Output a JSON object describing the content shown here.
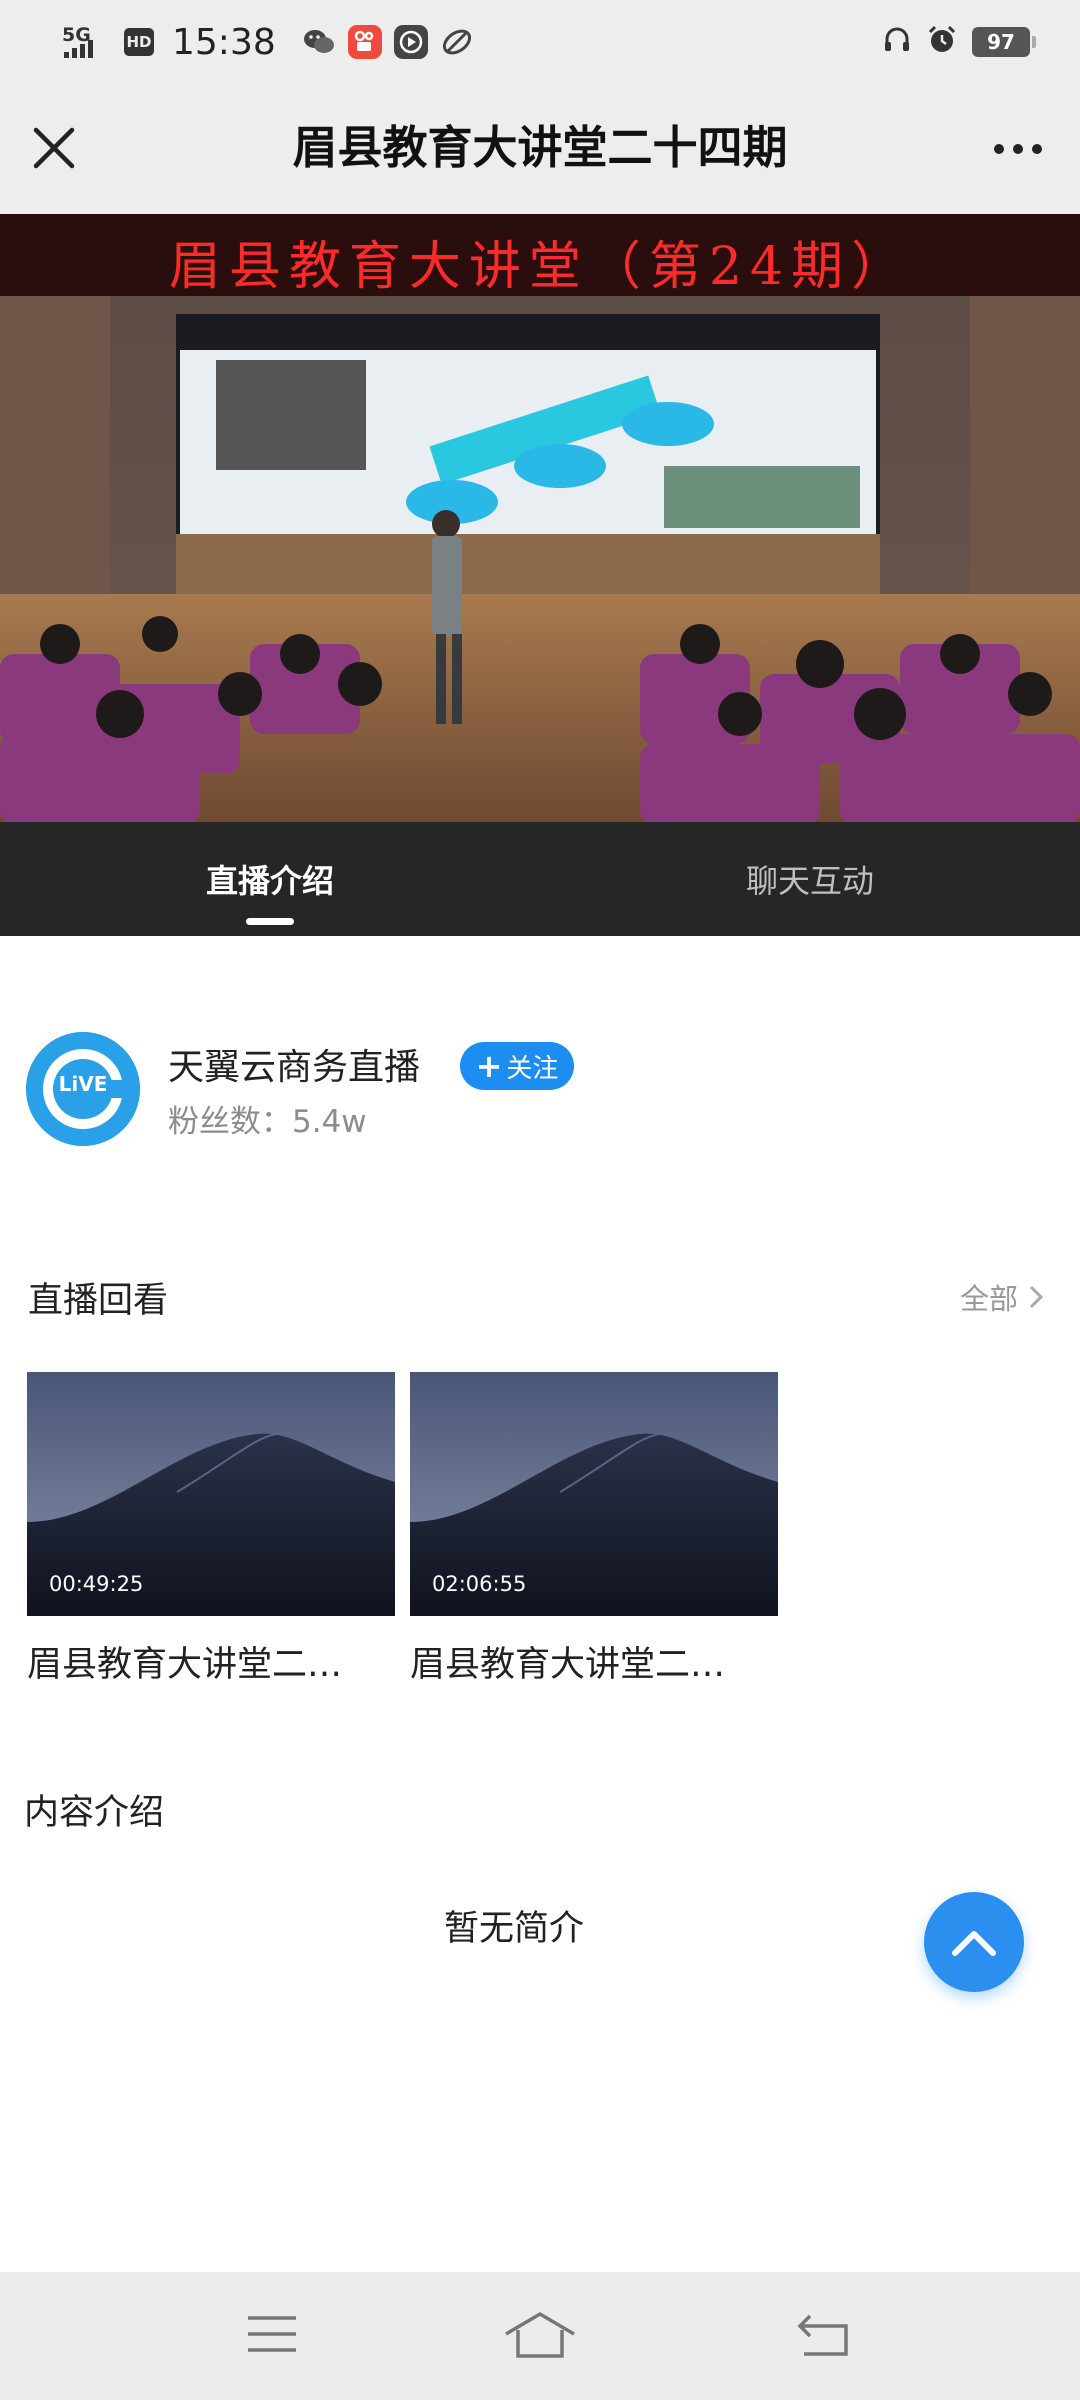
{
  "status_bar": {
    "network": "5G",
    "hd_badge": "HD",
    "time": "15:38",
    "battery": "97",
    "icons": [
      "signal-icon",
      "wechat-icon",
      "kuaishou-icon",
      "video-app-icon",
      "leaf-app-icon",
      "headphones-icon",
      "alarm-icon",
      "battery-icon"
    ]
  },
  "header": {
    "title": "眉县教育大讲堂二十四期",
    "close_icon": "close-icon",
    "more_icon": "more-dots-icon"
  },
  "video": {
    "banner_text": "眉县教育大讲堂（第24期）"
  },
  "tabs": [
    {
      "label": "直播介绍",
      "active": true
    },
    {
      "label": "聊天互动",
      "active": false
    }
  ],
  "broadcaster": {
    "avatar_text": "LiVE",
    "name": "天翼云商务直播",
    "follow_label": "关注",
    "follow_icon": "plus-icon",
    "fans_label": "粉丝数：",
    "fans_count": "5.4w"
  },
  "replay": {
    "section_title": "直播回看",
    "see_all_label": "全部",
    "items": [
      {
        "duration": "00:49:25",
        "title": "眉县教育大讲堂二…"
      },
      {
        "duration": "02:06:55",
        "title": "眉县教育大讲堂二…"
      }
    ]
  },
  "content": {
    "section_title": "内容介绍",
    "empty_text": "暂无简介"
  },
  "colors": {
    "accent": "#1c8ef2",
    "tab_bar_bg": "#262626",
    "header_bg": "#ededed"
  },
  "nav_bar": {
    "buttons": [
      "menu-icon",
      "home-icon",
      "back-icon"
    ]
  }
}
